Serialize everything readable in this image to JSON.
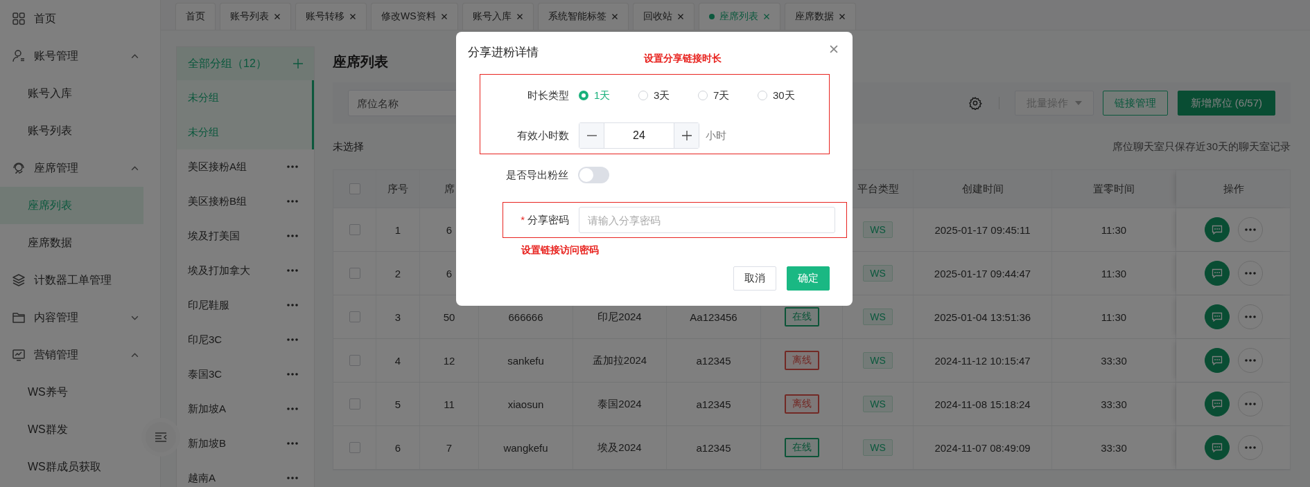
{
  "sidebar": {
    "items": [
      {
        "label": "首页",
        "selected": false
      },
      {
        "label": "账号管理",
        "selected": false,
        "expanded": true,
        "children": [
          {
            "label": "账号入库",
            "selected": false
          },
          {
            "label": "账号列表",
            "selected": false
          }
        ]
      },
      {
        "label": "座席管理",
        "selected": false,
        "expanded": true,
        "children": [
          {
            "label": "座席列表",
            "selected": true
          },
          {
            "label": "座席数据",
            "selected": false
          }
        ]
      },
      {
        "label": "计数器工单管理",
        "selected": false
      },
      {
        "label": "内容管理",
        "selected": false,
        "expanded": false
      },
      {
        "label": "营销管理",
        "selected": false,
        "expanded": true,
        "children": [
          {
            "label": "WS养号",
            "selected": false
          },
          {
            "label": "WS群发",
            "selected": false
          },
          {
            "label": "WS群成员获取",
            "selected": false
          }
        ]
      }
    ]
  },
  "tabs": [
    {
      "label": "首页",
      "closable": false,
      "selected": false
    },
    {
      "label": "账号列表",
      "closable": true,
      "selected": false
    },
    {
      "label": "账号转移",
      "closable": true,
      "selected": false
    },
    {
      "label": "修改WS资料",
      "closable": true,
      "selected": false
    },
    {
      "label": "账号入库",
      "closable": true,
      "selected": false
    },
    {
      "label": "系统智能标签",
      "closable": true,
      "selected": false
    },
    {
      "label": "回收站",
      "closable": true,
      "selected": false
    },
    {
      "label": "座席列表",
      "closable": true,
      "selected": true
    },
    {
      "label": "座席数据",
      "closable": true,
      "selected": false
    }
  ],
  "groups": {
    "header": "全部分组（12）",
    "items": [
      {
        "label": "未分组",
        "selected": true,
        "menu": false
      },
      {
        "label": "未分组",
        "selected": true,
        "menu": false
      },
      {
        "label": "美区接粉A组",
        "selected": false,
        "menu": true
      },
      {
        "label": "美区接粉B组",
        "selected": false,
        "menu": true
      },
      {
        "label": "埃及打美国",
        "selected": false,
        "menu": true
      },
      {
        "label": "埃及打加拿大",
        "selected": false,
        "menu": true
      },
      {
        "label": "印尼鞋服",
        "selected": false,
        "menu": true
      },
      {
        "label": "印尼3C",
        "selected": false,
        "menu": true
      },
      {
        "label": "泰国3C",
        "selected": false,
        "menu": true
      },
      {
        "label": "新加坡A",
        "selected": false,
        "menu": true
      },
      {
        "label": "新加坡B",
        "selected": false,
        "menu": true
      },
      {
        "label": "越南A",
        "selected": false,
        "menu": true
      }
    ]
  },
  "page": {
    "title": "座席列表",
    "filter": {
      "placeholder": "席位名称"
    },
    "toolbar": {
      "batch": {
        "label": "批量操作",
        "disabled": true
      },
      "links": "链接管理",
      "add": "新增席位 (6/57)"
    },
    "selection": "未选择",
    "note": "席位聊天室只保存近30天的聊天室记录"
  },
  "table": {
    "header": {
      "checked": false,
      "index": "序号",
      "seat": "席",
      "platform": "平台类型",
      "created": "创建时间",
      "reset_time": "置零时间",
      "actions": "操作"
    },
    "rows": [
      {
        "checked": false,
        "index": "1",
        "seat": "6",
        "platform": "WS",
        "created": "2025-01-17 09:45:11",
        "reset_time": "11:30"
      },
      {
        "checked": false,
        "index": "2",
        "seat": "6",
        "platform": "WS",
        "created": "2025-01-17 09:44:47",
        "reset_time": "11:30"
      },
      {
        "checked": false,
        "index": "3",
        "seat": "50",
        "account": "666666",
        "group": "印尼2024",
        "password": "Aa123456",
        "status": {
          "label": "在线",
          "color": "#0c5438"
        },
        "platform": "WS",
        "created": "2025-01-04 13:51:36",
        "reset_time": "11:30"
      },
      {
        "checked": false,
        "index": "4",
        "seat": "12",
        "account": "sankefu",
        "group": "孟加拉2024",
        "password": "a12345",
        "status": {
          "label": "离线",
          "color": "#722925"
        },
        "platform": "WS",
        "created": "2024-11-12 10:15:47",
        "reset_time": "33:30"
      },
      {
        "checked": false,
        "index": "5",
        "seat": "11",
        "account": "xiaosun",
        "group": "泰国2024",
        "password": "a12345",
        "status": {
          "label": "离线",
          "color": "#722925"
        },
        "platform": "WS",
        "created": "2024-11-08 15:18:24",
        "reset_time": "33:30"
      },
      {
        "checked": false,
        "index": "6",
        "seat": "7",
        "account": "wangkefu",
        "group": "埃及2024",
        "password": "a12345",
        "status": {
          "label": "在线",
          "color": "#0c5438"
        },
        "platform": "WS",
        "created": "2024-11-07 08:49:09",
        "reset_time": "33:30"
      }
    ]
  },
  "dialog": {
    "title": "分享进粉详情",
    "duration": {
      "label": "时长类型",
      "options": [
        {
          "label": "1天",
          "selected": true
        },
        {
          "label": "3天",
          "selected": false
        },
        {
          "label": "7天",
          "selected": false
        },
        {
          "label": "30天",
          "selected": false
        }
      ]
    },
    "hours": {
      "label": "有效小时数",
      "value": "24",
      "unit": "小时"
    },
    "export": {
      "label": "是否导出粉丝",
      "on": false
    },
    "password": {
      "label": "分享密码",
      "marker": "*",
      "placeholder": "请输入分享密码"
    },
    "cancel": "取消",
    "confirm": "确定",
    "annotations": [
      "设置分享链接时长",
      "设置链接访问密码"
    ]
  }
}
